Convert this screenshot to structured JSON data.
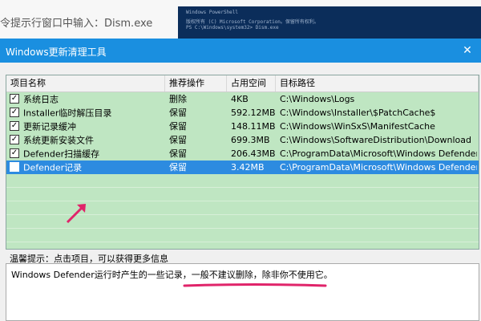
{
  "background": {
    "instruction_text": "令提示行窗口中输入：Dism.exe",
    "console_lines": [
      "Windows PowerShell",
      "版权所有 (C) Microsoft Corporation。保留所有权利。",
      "PS C:\\Windows\\system32> Dism.exe"
    ]
  },
  "window": {
    "title": "Windows更新清理工具",
    "close_label": "✕"
  },
  "table": {
    "columns": [
      "项目名称",
      "推荐操作",
      "占用空间",
      "目标路径"
    ],
    "rows": [
      {
        "checked": true,
        "name": "系统日志",
        "action": "删除",
        "size": "4KB",
        "path": "C:\\Windows\\Logs"
      },
      {
        "checked": true,
        "name": "Installer临时解压目录",
        "action": "保留",
        "size": "592.12MB",
        "path": "C:\\Windows\\Installer\\$PatchCache$"
      },
      {
        "checked": true,
        "name": "更新记录缓冲",
        "action": "保留",
        "size": "148.11MB",
        "path": "C:\\Windows\\WinSxS\\ManifestCache"
      },
      {
        "checked": true,
        "name": "系统更新安装文件",
        "action": "保留",
        "size": "699.3MB",
        "path": "C:\\Windows\\SoftwareDistribution\\Download"
      },
      {
        "checked": true,
        "name": "Defender扫描缓存",
        "action": "保留",
        "size": "206.43MB",
        "path": "C:\\ProgramData\\Microsoft\\Windows Defender\\Scans"
      },
      {
        "checked": false,
        "name": "Defender记录",
        "action": "保留",
        "size": "3.42MB",
        "path": "C:\\ProgramData\\Microsoft\\Windows Defender\\Support",
        "selected": true
      }
    ]
  },
  "hint": {
    "label": "温馨提示：点击项目，可以获得更多信息",
    "text": "Windows Defender运行时产生的一些记录，一般不建议删除，除非你不使用它。"
  },
  "colors": {
    "title_bar": "#1a8fe0",
    "list_background": "#bfe6c2",
    "selection": "#2d8be0",
    "annotation": "#e0246a"
  },
  "icons": [
    "close-icon",
    "checkbox-icon",
    "annotation-arrow-icon"
  ]
}
